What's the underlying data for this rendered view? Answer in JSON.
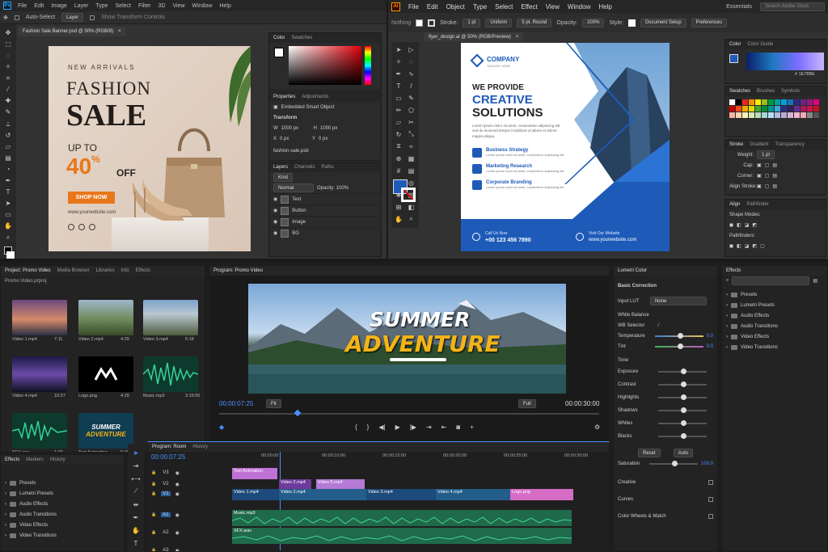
{
  "ps": {
    "menu": [
      "File",
      "Edit",
      "Image",
      "Layer",
      "Type",
      "Select",
      "Filter",
      "3D",
      "View",
      "Window",
      "Help"
    ],
    "opts": [
      "Auto-Select",
      "Layer",
      "Show Transform Controls"
    ],
    "tab": "Fashion Sale Banner.psd @ 50% (RGB/8)",
    "banner": {
      "eyebrow": "NEW ARRIVALS",
      "l1": "FASHION",
      "l2": "SALE",
      "upto": "UP TO",
      "pct": "40",
      "pctsign": "%",
      "off": "OFF",
      "cta": "SHOP NOW",
      "url": "www.yourwebsite.com"
    },
    "color_tabs": [
      "Color",
      "Swatches"
    ],
    "props_tabs": [
      "Properties",
      "Adjustments"
    ],
    "props": {
      "embedded": "Embedded Smart Object",
      "transform": "Transform",
      "w": "W",
      "wv": "1000 px",
      "h": "H",
      "hv": "1000 px",
      "x": "X",
      "xv": "0 px",
      "y": "Y",
      "yv": "0 px",
      "file": "fashion-sale.psb"
    },
    "layers_tabs": [
      "Layers",
      "Channels",
      "Paths"
    ],
    "kind": "Kind",
    "normal": "Normal",
    "opacity": "Opacity: 100%",
    "layers": [
      "Text",
      "Button",
      "Image",
      "BG"
    ]
  },
  "ai": {
    "logo": "Ai",
    "menu": [
      "File",
      "Edit",
      "Object",
      "Type",
      "Select",
      "Effect",
      "View",
      "Window",
      "Help"
    ],
    "ctrl": {
      "label": "Nothing",
      "stroke": "Stroke:",
      "stroke_v": "1 pt",
      "uniform": "Uniform",
      "round": "5 pt. Round",
      "opacity": "Opacity:",
      "opacity_v": "100%",
      "style": "Style:",
      "docsetup": "Document Setup",
      "prefs": "Preferences"
    },
    "essentials": "Essentials",
    "search_placeholder": "Search Adobe Stock",
    "tab": "flyer_design.ai @ 50% (RGB/Preview)",
    "flyer": {
      "company": "COMPANY",
      "tagline": "TAGLINE HERE",
      "we": "WE PROVIDE",
      "creative": "CREATIVE",
      "solutions": "SOLUTIONS",
      "lorem": "Lorem ipsum dolor sit amet, consectetur adipiscing elit, sed do eiusmod tempor incididunt ut labore et dolore magna aliqua.",
      "services": [
        {
          "t": "Business Strategy",
          "d": "Lorem ipsum dolor sit amet, consectetur adipiscing elit."
        },
        {
          "t": "Marketing Research",
          "d": "Lorem ipsum dolor sit amet, consectetur adipiscing elit."
        },
        {
          "t": "Corporate Branding",
          "d": "Lorem ipsum dolor sit amet, consectetur adipiscing elit."
        }
      ],
      "call": "Call Us Now",
      "phone": "+00 123 456 7890",
      "visit": "Visit Our Website",
      "web": "www.yourwebsite.com"
    },
    "color_tabs": [
      "Color",
      "Color Guide"
    ],
    "hex": "1E78BE",
    "swatch_tabs": [
      "Swatches",
      "Brushes",
      "Symbols"
    ],
    "stroke_tabs": [
      "Stroke",
      "Gradient",
      "Transparency"
    ],
    "stroke": {
      "weight": "Weight:",
      "weight_v": "1 pt",
      "cap": "Cap:",
      "corner": "Corner:",
      "align": "Align Stroke:"
    },
    "align_tabs": [
      "Align",
      "Pathfinder"
    ],
    "shape_modes": "Shape Modes:",
    "pathfinders": "Pathfinders:"
  },
  "pr": {
    "project_tabs": [
      "Project: Promo Video",
      "Media Browser",
      "Libraries",
      "Info",
      "Effects"
    ],
    "project_file": "Promo Video.prproj",
    "media": [
      {
        "n": "Video 1.mp4",
        "d": "7:11"
      },
      {
        "n": "Video 2.mp4",
        "d": "4:29"
      },
      {
        "n": "Video 3.mp4",
        "d": "5:18"
      },
      {
        "n": "Video 4.mp4",
        "d": "10:27"
      },
      {
        "n": "Logo.png",
        "d": "4:29"
      },
      {
        "n": "Music.mp3",
        "d": "3:15:00"
      },
      {
        "n": "SFX.wav",
        "d": "1:03"
      },
      {
        "n": "Text Animation",
        "d": "5:00"
      }
    ],
    "thumb_text": {
      "summer": "SUMMER",
      "adventure": "ADVENTURE"
    },
    "effects_tabs": [
      "Effects",
      "Markers",
      "History"
    ],
    "effects_list": [
      "Presets",
      "Lumetri Presets",
      "Audio Effects",
      "Audio Transitions",
      "Video Effects",
      "Video Transitions"
    ],
    "program": "Program: Promo Video",
    "title": {
      "l1": "SUMMER",
      "l2": "ADVENTURE"
    },
    "tc_in": "00:00:07:25",
    "fit": "Fit",
    "full": "Full",
    "tc_dur": "00:00:30:00",
    "timeline_tabs": [
      "Program: Room",
      "History"
    ],
    "timeline_tc": "00:00:07:25",
    "ruler": [
      "00:00:00",
      "00:00:10:00",
      "00:00:15:00",
      "00:00:20:00",
      "00:00:25:00",
      "00:00:30:00"
    ],
    "tracks": [
      "V3",
      "V2",
      "V1",
      "A1",
      "A2",
      "A3"
    ],
    "clips": {
      "text": "Text Animation",
      "v2": "Video 2.mp4",
      "v5": "Video 5.mp4",
      "v1": "Video 1.mp4",
      "v3": "Video 3.mp4",
      "v4": "Video 4.mp4",
      "logo": "Logo.png",
      "music": "Music.mp3",
      "sfx": "SFX.wav"
    },
    "lumetri": {
      "title": "Lumetri Color",
      "basic": "Basic Correction",
      "input_lut": "Input LUT",
      "none": "None",
      "wb": "White Balance",
      "wb_sel": "WB Selector",
      "temperature": "Temperature",
      "tint": "Tint",
      "tone": "Tone",
      "exposure": "Exposure",
      "contrast": "Contrast",
      "highlights": "Highlights",
      "shadows": "Shadows",
      "whites": "Whites",
      "blacks": "Blacks",
      "reset": "Reset",
      "auto": "Auto",
      "saturation": "Saturation",
      "sat_v": "100.0",
      "temp_v": "0.0",
      "tint_v": "0.0",
      "creative": "Creative",
      "curves": "Curves",
      "wheels": "Color Wheels & Match"
    },
    "effects2": "Effects"
  },
  "colors": {
    "ps_blue": "#31a8ff",
    "ai_orange": "#ff9a00",
    "flyer_blue": "#1e5bb8",
    "pr_purple": "#9999ff"
  }
}
